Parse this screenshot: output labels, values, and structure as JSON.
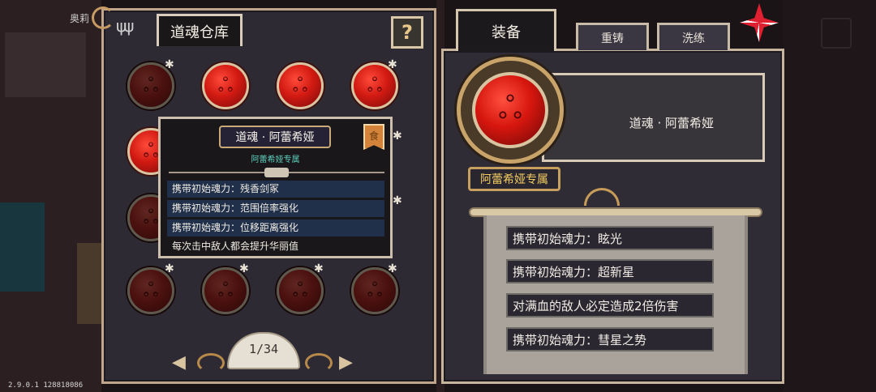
{
  "hud": {
    "npc_name": "奥莉",
    "version": "2.9.0.1 128818086"
  },
  "warehouse": {
    "title": "道魂仓库",
    "help_label": "?",
    "pager": {
      "prev": "◀",
      "next": "▶",
      "page_text": "1/34"
    },
    "orb_glyph": "ஃ",
    "star_glyph": "✱"
  },
  "tooltip": {
    "title": "道魂 · 阿蕾希娅",
    "badge": "食",
    "subtitle": "阿蕾希娅专属",
    "effects": [
      "携带初始魂力：残香剑冢",
      "携带初始魂力：范围倍率强化",
      "携带初始魂力：位移距离强化",
      "每次击中敌人都会提升华丽值"
    ]
  },
  "equip": {
    "tabs": {
      "equip": "装备",
      "recast": "重铸",
      "refine": "洗练"
    },
    "soul_name": "道魂 · 阿蕾希娅",
    "exclusive_label": "阿蕾希娅专属",
    "effects": [
      "携带初始魂力：眩光",
      "携带初始魂力：超新星",
      "对满血的敌人必定造成2倍伤害",
      "携带初始魂力：彗星之势"
    ]
  },
  "colors": {
    "orb_red": "#d21a12",
    "accent_gold": "#c79f5e",
    "exclusive_text": "#f3cc60",
    "subtitle_teal": "#5fd0bf",
    "panel_bg": "#2d2a34"
  },
  "icons": [
    "help-icon",
    "close-pinwheel-icon",
    "candle-pole-icon",
    "soul-orb-icon",
    "star-icon",
    "arrow-left-icon",
    "arrow-right-icon"
  ]
}
